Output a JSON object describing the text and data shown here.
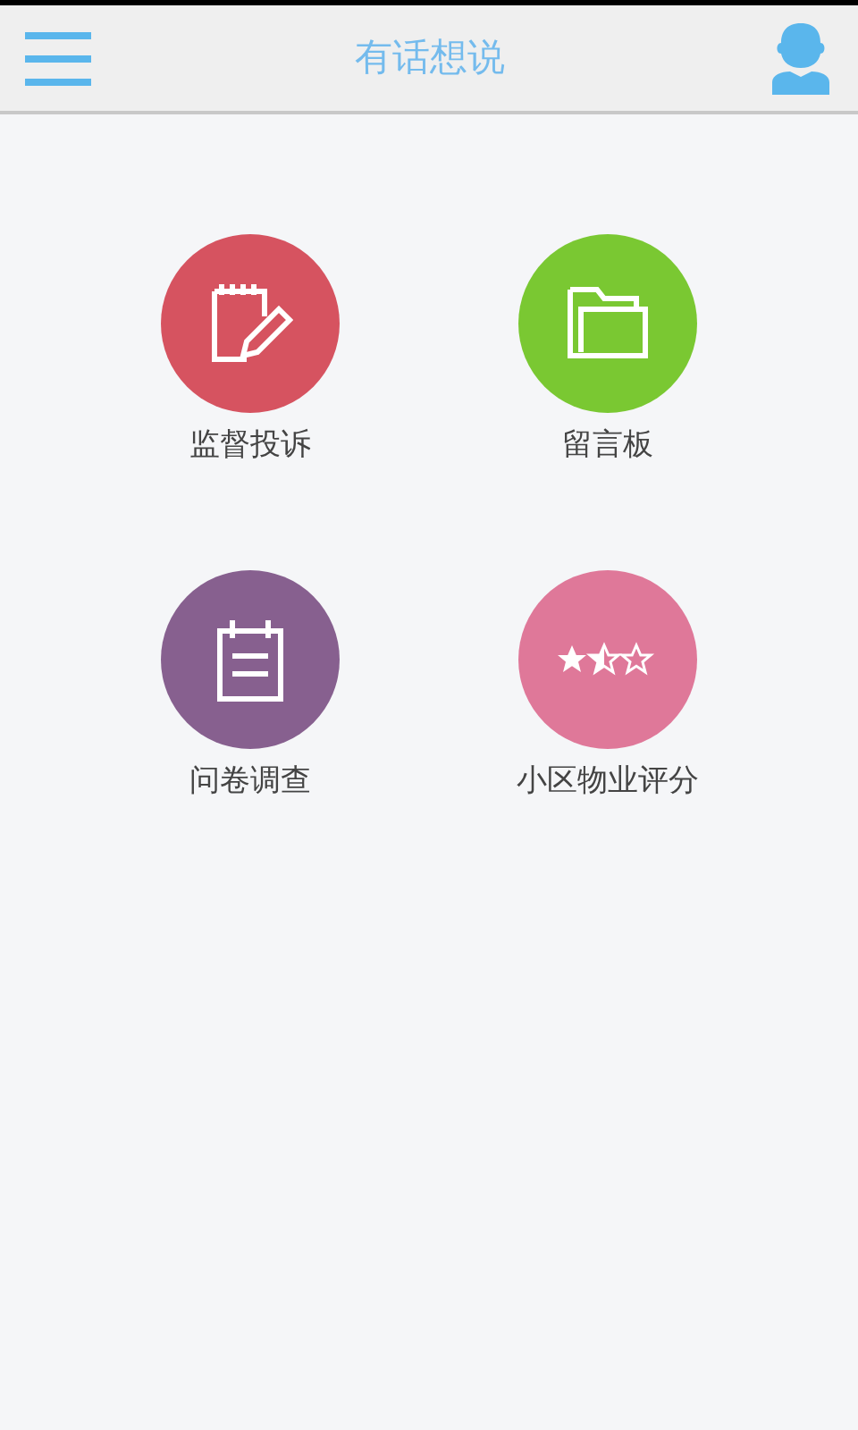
{
  "header": {
    "title": "有话想说"
  },
  "tiles": [
    {
      "label": "监督投诉",
      "color": "#d65360",
      "kind": "note"
    },
    {
      "label": "留言板",
      "color": "#7ac832",
      "kind": "folder"
    },
    {
      "label": "问卷调查",
      "color": "#87608f",
      "kind": "calendar"
    },
    {
      "label": "小区物业评分",
      "color": "#df7899",
      "kind": "rating"
    }
  ]
}
